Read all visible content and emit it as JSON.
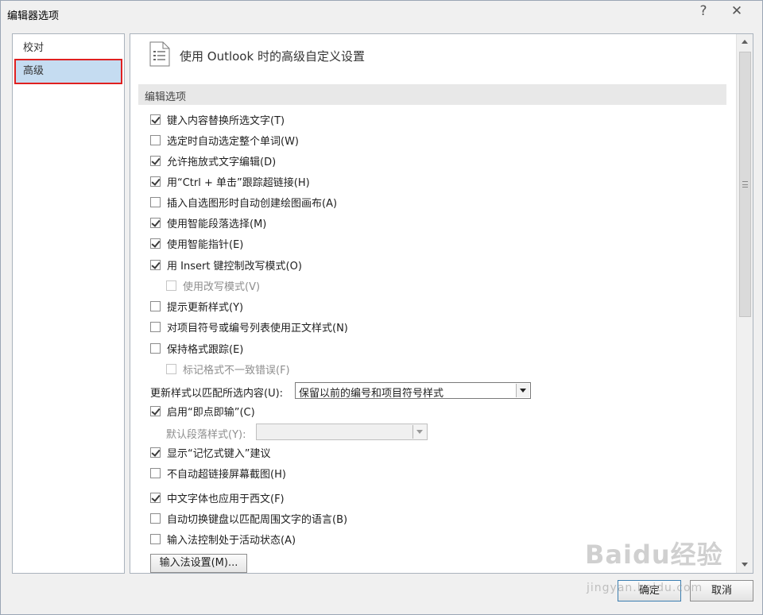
{
  "window": {
    "title": "编辑器选项",
    "help": "?",
    "close": "✕"
  },
  "nav": {
    "items": [
      {
        "label": "校对",
        "selected": false
      },
      {
        "label": "高级",
        "selected": true
      }
    ]
  },
  "content": {
    "header_title": "使用 Outlook 时的高级自定义设置",
    "section_title": "编辑选项",
    "options": [
      {
        "label": "键入内容替换所选文字(T)",
        "checked": true
      },
      {
        "label": "选定时自动选定整个单词(W)",
        "checked": false
      },
      {
        "label": "允许拖放式文字编辑(D)",
        "checked": true
      },
      {
        "label": "用“Ctrl + 单击”跟踪超链接(H)",
        "checked": true
      },
      {
        "label": "插入自选图形时自动创建绘图画布(A)",
        "checked": false
      },
      {
        "label": "使用智能段落选择(M)",
        "checked": true
      },
      {
        "label": "使用智能指针(E)",
        "checked": true
      },
      {
        "label": "用 Insert 键控制改写模式(O)",
        "checked": true
      },
      {
        "label": "使用改写模式(V)",
        "checked": false,
        "disabled": true
      },
      {
        "label": "提示更新样式(Y)",
        "checked": false
      },
      {
        "label": "对项目符号或编号列表使用正文样式(N)",
        "checked": false
      },
      {
        "label": "保持格式跟踪(E)",
        "checked": false
      },
      {
        "label": "标记格式不一致错误(F)",
        "checked": false,
        "disabled": true
      }
    ],
    "update_style_label": "更新样式以匹配所选内容(U):",
    "update_style_value": "保留以前的编号和项目符号样式",
    "options2": [
      {
        "label": "启用“即点即输”(C)",
        "checked": true
      }
    ],
    "default_para_label": "默认段落样式(Y):",
    "default_para_value": "",
    "options3": [
      {
        "label": "显示“记忆式键入”建议",
        "checked": true
      },
      {
        "label": "不自动超链接屏幕截图(H)",
        "checked": false
      },
      {
        "label": "中文字体也应用于西文(F)",
        "checked": true
      },
      {
        "label": "自动切换键盘以匹配周围文字的语言(B)",
        "checked": false
      },
      {
        "label": "输入法控制处于活动状态(A)",
        "checked": false
      }
    ],
    "ime_button": "输入法设置(M)..."
  },
  "footer": {
    "ok": "确定",
    "cancel": "取消"
  },
  "watermark": {
    "text": "Baidu经验",
    "sub": "jingyan.baidu.com"
  },
  "colors": {
    "selected_nav_bg": "#c5dcf1",
    "highlight_border": "#e02020",
    "section_band": "#e8e8e8"
  }
}
